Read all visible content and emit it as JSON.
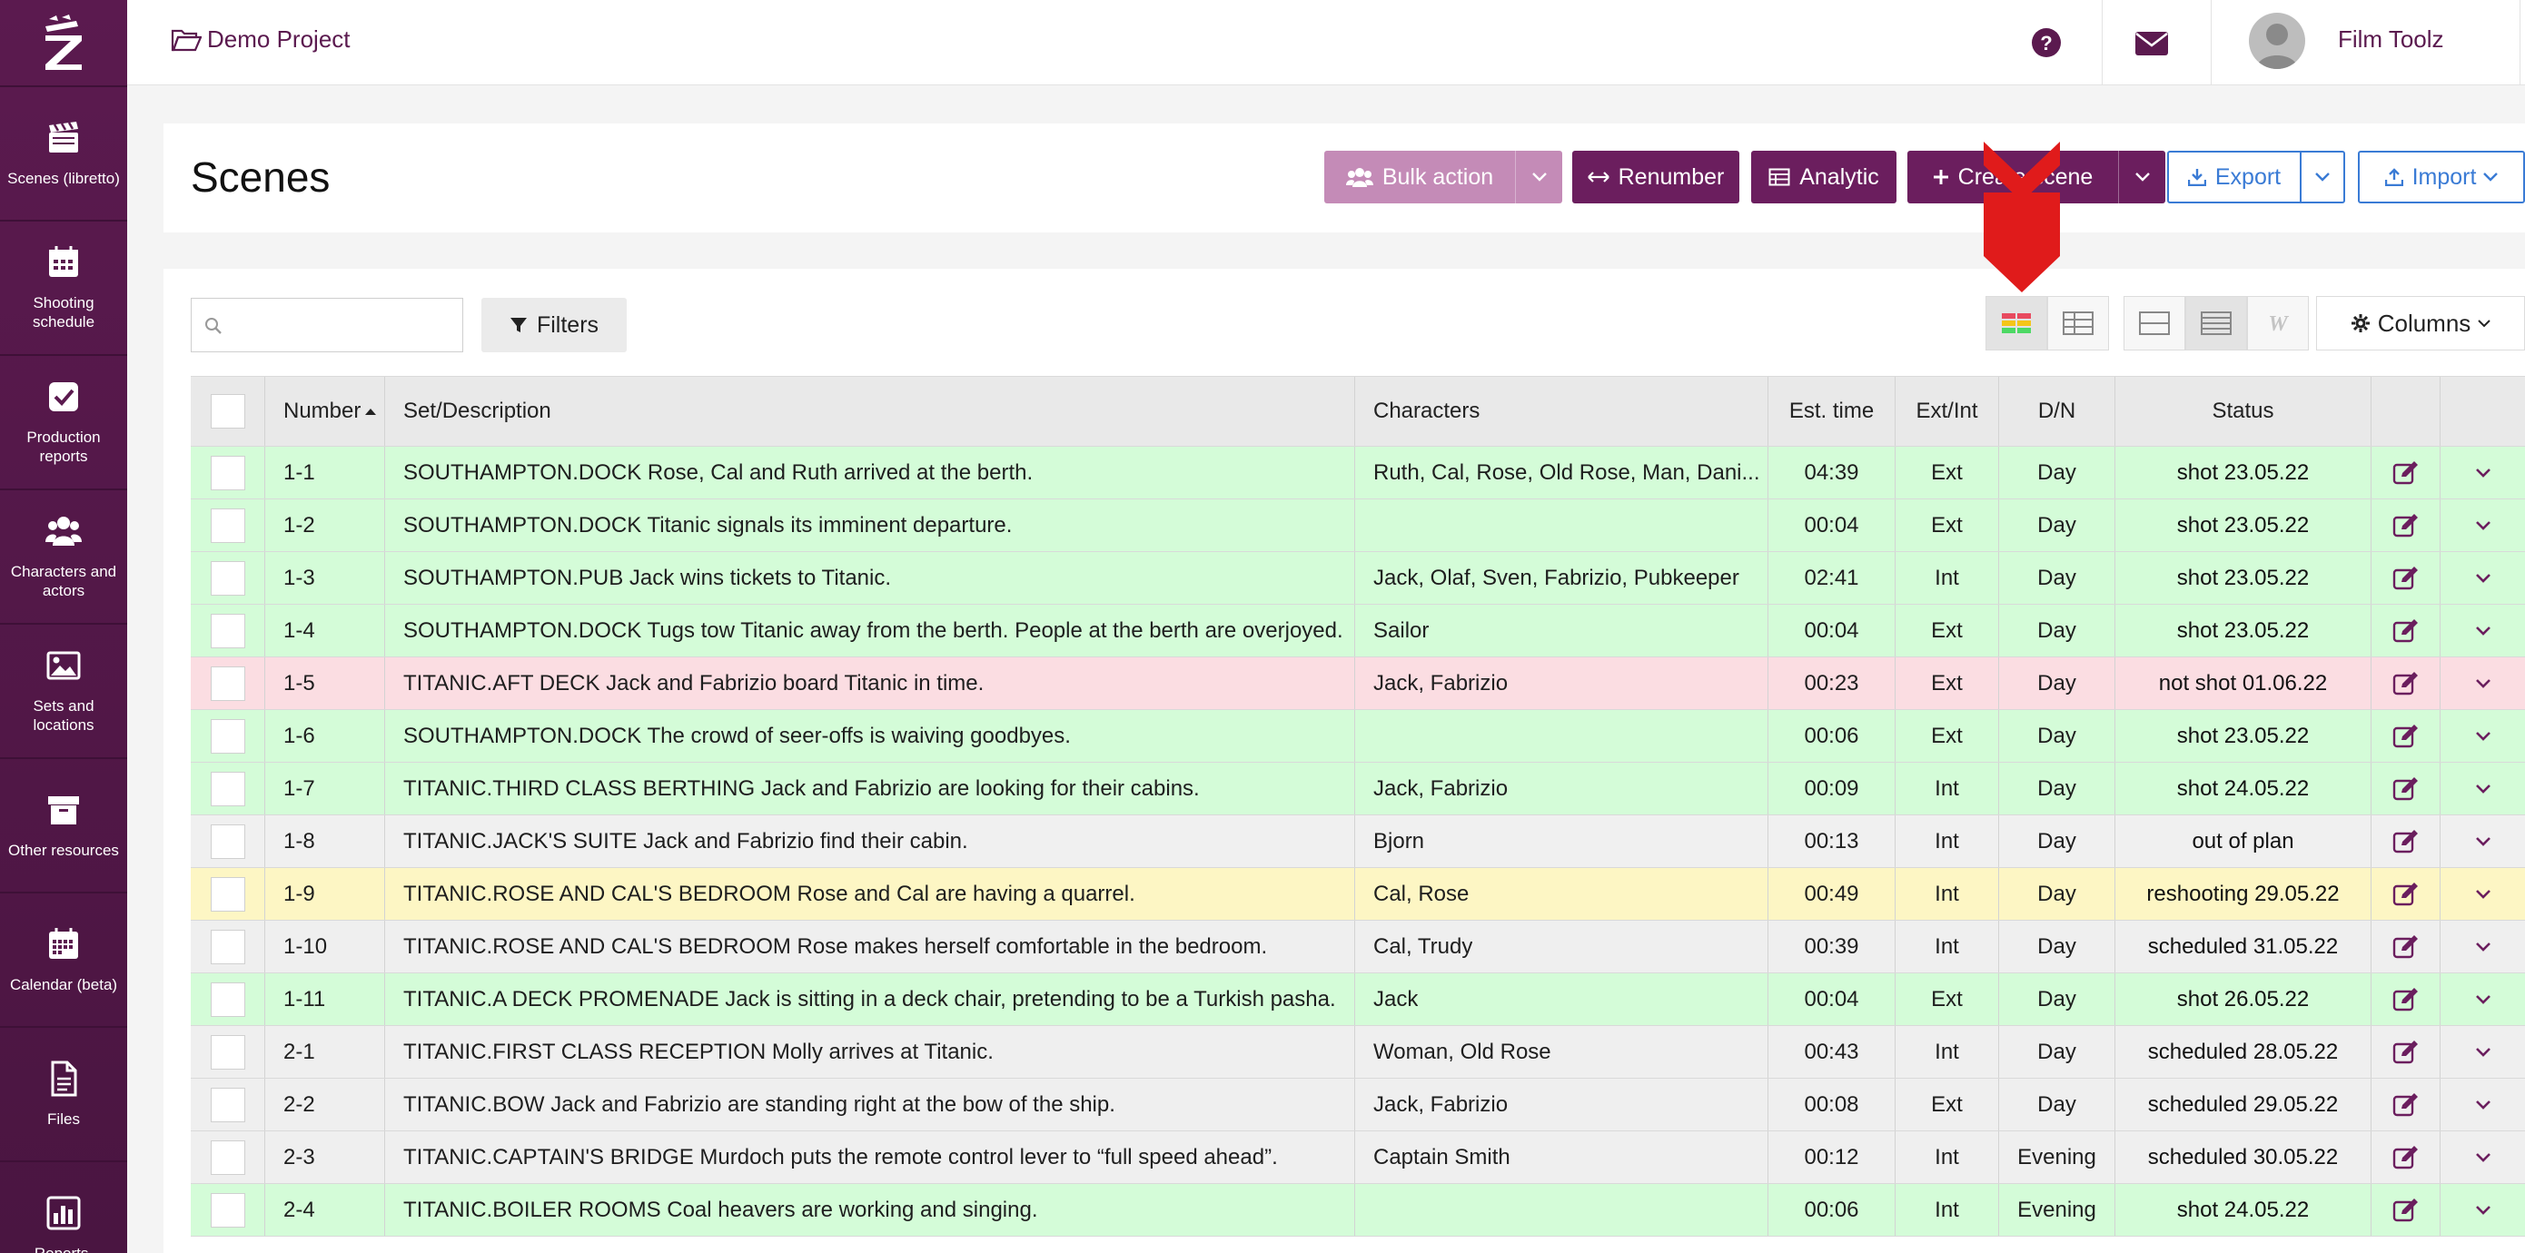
{
  "brand": {
    "accent": "#5b1a4f",
    "button": "#6b1e5e",
    "link_blue": "#3a7bd5"
  },
  "sidebar": {
    "items": [
      {
        "label": "Scenes (libretto)",
        "icon": "clapperboard-icon"
      },
      {
        "label": "Shooting schedule",
        "icon": "calendar-icon"
      },
      {
        "label": "Production reports",
        "icon": "checkbox-icon"
      },
      {
        "label": "Characters and actors",
        "icon": "users-icon"
      },
      {
        "label": "Sets and locations",
        "icon": "image-icon"
      },
      {
        "label": "Other resources",
        "icon": "archive-icon"
      },
      {
        "label": "Calendar (beta)",
        "icon": "calendar-grid-icon"
      },
      {
        "label": "Files",
        "icon": "file-icon"
      },
      {
        "label": "Reports,",
        "icon": "bar-chart-icon"
      }
    ]
  },
  "topbar": {
    "project": "Demo Project",
    "user": "Film Toolz"
  },
  "page": {
    "title": "Scenes",
    "buttons": {
      "bulk": "Bulk action",
      "renumber": "Renumber",
      "analytic": "Analytic",
      "create": "Create scene",
      "export": "Export",
      "import": "Import"
    }
  },
  "toolbar": {
    "search_placeholder": "",
    "filters": "Filters",
    "columns": "Columns"
  },
  "table": {
    "headers": {
      "number": "Number",
      "set": "Set/Description",
      "characters": "Characters",
      "est": "Est. time",
      "extint": "Ext/Int",
      "dn": "D/N",
      "status": "Status"
    },
    "rows": [
      {
        "num": "1-1",
        "set": "SOUTHAMPTON.DOCK Rose, Cal and Ruth arrived at the berth.",
        "chars": "Ruth, Cal, Rose, Old Rose, Man, Dani...",
        "est": "04:39",
        "ei": "Ext",
        "dn": "Day",
        "status": "shot 23.05.22",
        "state": "shot"
      },
      {
        "num": "1-2",
        "set": "SOUTHAMPTON.DOCK Titanic signals its imminent departure.",
        "chars": "",
        "est": "00:04",
        "ei": "Ext",
        "dn": "Day",
        "status": "shot 23.05.22",
        "state": "shot"
      },
      {
        "num": "1-3",
        "set": "SOUTHAMPTON.PUB Jack wins tickets to Titanic.",
        "chars": "Jaсk, Olaf, Sven, Fabrizio, Pubkeeper",
        "est": "02:41",
        "ei": "Int",
        "dn": "Day",
        "status": "shot 23.05.22",
        "state": "shot"
      },
      {
        "num": "1-4",
        "set": "SOUTHAMPTON.DOCK Tugs tow Titanic away from the berth. People at the berth are overjoyed.",
        "chars": "Sailor",
        "est": "00:04",
        "ei": "Ext",
        "dn": "Day",
        "status": "shot 23.05.22",
        "state": "shot"
      },
      {
        "num": "1-5",
        "set": "TITANIC.AFT DECK Jack and Fabrizio board Titanic in time.",
        "chars": "Jaсk, Fabrizio",
        "est": "00:23",
        "ei": "Ext",
        "dn": "Day",
        "status": "not shot 01.06.22",
        "state": "notshot"
      },
      {
        "num": "1-6",
        "set": "SOUTHAMPTON.DOCK The crowd of seer-offs is waiving goodbyes.",
        "chars": "",
        "est": "00:06",
        "ei": "Ext",
        "dn": "Day",
        "status": "shot 23.05.22",
        "state": "shot"
      },
      {
        "num": "1-7",
        "set": "TITANIC.THIRD CLASS BERTHING Jack and Fabrizio are looking for their cabins.",
        "chars": "Jaсk, Fabrizio",
        "est": "00:09",
        "ei": "Int",
        "dn": "Day",
        "status": "shot 24.05.22",
        "state": "shot"
      },
      {
        "num": "1-8",
        "set": "TITANIC.JACK'S SUITE Jack and Fabrizio find their cabin.",
        "chars": "Bjorn",
        "est": "00:13",
        "ei": "Int",
        "dn": "Day",
        "status": "out of plan",
        "state": "plan"
      },
      {
        "num": "1-9",
        "set": "TITANIC.ROSE AND CAL'S BEDROOM Rose and Cal are having a quarrel.",
        "chars": "Cal, Rose",
        "est": "00:49",
        "ei": "Int",
        "dn": "Day",
        "status": "reshooting 29.05.22",
        "state": "reshoot"
      },
      {
        "num": "1-10",
        "set": "TITANIC.ROSE AND CAL'S BEDROOM Rose makes herself comfortable in the bedroom.",
        "chars": "Cal, Trudy",
        "est": "00:39",
        "ei": "Int",
        "dn": "Day",
        "status": "scheduled 31.05.22",
        "state": "sched"
      },
      {
        "num": "1-11",
        "set": "TITANIC.A DECK PROMENADE Jack is sitting in a deck chair, pretending to be a Turkish pasha.",
        "chars": "Jaсk",
        "est": "00:04",
        "ei": "Ext",
        "dn": "Day",
        "status": "shot 26.05.22",
        "state": "shot"
      },
      {
        "num": "2-1",
        "set": "TITANIC.FIRST CLASS RECEPTION Molly arrives at Titanic.",
        "chars": "Woman, Old Rose",
        "est": "00:43",
        "ei": "Int",
        "dn": "Day",
        "status": "scheduled 28.05.22",
        "state": "sched"
      },
      {
        "num": "2-2",
        "set": "TITANIC.BOW Jack and Fabrizio are standing right at the bow of the ship.",
        "chars": "Jaсk, Fabrizio",
        "est": "00:08",
        "ei": "Ext",
        "dn": "Day",
        "status": "scheduled 29.05.22",
        "state": "sched"
      },
      {
        "num": "2-3",
        "set": "TITANIC.CAPTAIN'S BRIDGE Murdoch puts the remote control lever to “full speed ahead”.",
        "chars": "Captain Smith",
        "est": "00:12",
        "ei": "Int",
        "dn": "Evening",
        "status": "scheduled 30.05.22",
        "state": "sched"
      },
      {
        "num": "2-4",
        "set": "TITANIC.BOILER ROOMS Coal heavers are working and singing.",
        "chars": "",
        "est": "00:06",
        "ei": "Int",
        "dn": "Evening",
        "status": "shot 24.05.22",
        "state": "shot"
      }
    ]
  }
}
